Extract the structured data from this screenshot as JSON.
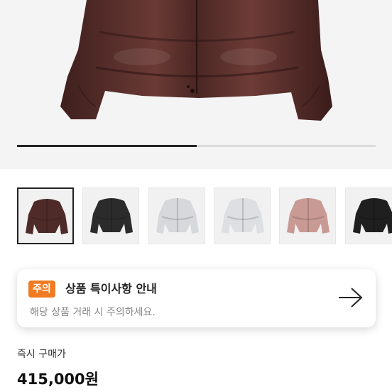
{
  "gallery": {
    "progress_fraction": 0.5,
    "main_image": "brown-puffer-jacket",
    "thumbnails": [
      {
        "name": "thumb-brown-jacket",
        "color": "#4e2b28",
        "active": true
      },
      {
        "name": "thumb-black-jacket",
        "color": "#2b2b2b",
        "active": false
      },
      {
        "name": "thumb-silver-jacket",
        "color": "#d7d8dc",
        "active": false
      },
      {
        "name": "thumb-silver-black-jacket",
        "color": "#dedfe3",
        "active": false
      },
      {
        "name": "thumb-pink-jacket",
        "color": "#c99a94",
        "active": false
      },
      {
        "name": "thumb-black-jacket-2",
        "color": "#1f1f1f",
        "active": false
      }
    ]
  },
  "notice": {
    "badge": "주의",
    "title": "상품 특이사항 안내",
    "description": "해당 상품 거래 시 주의하세요.",
    "arrow_icon": "arrow-right-icon",
    "badge_color": "#f07b22"
  },
  "purchase": {
    "label": "즉시 구매가",
    "price": "415,000원"
  }
}
